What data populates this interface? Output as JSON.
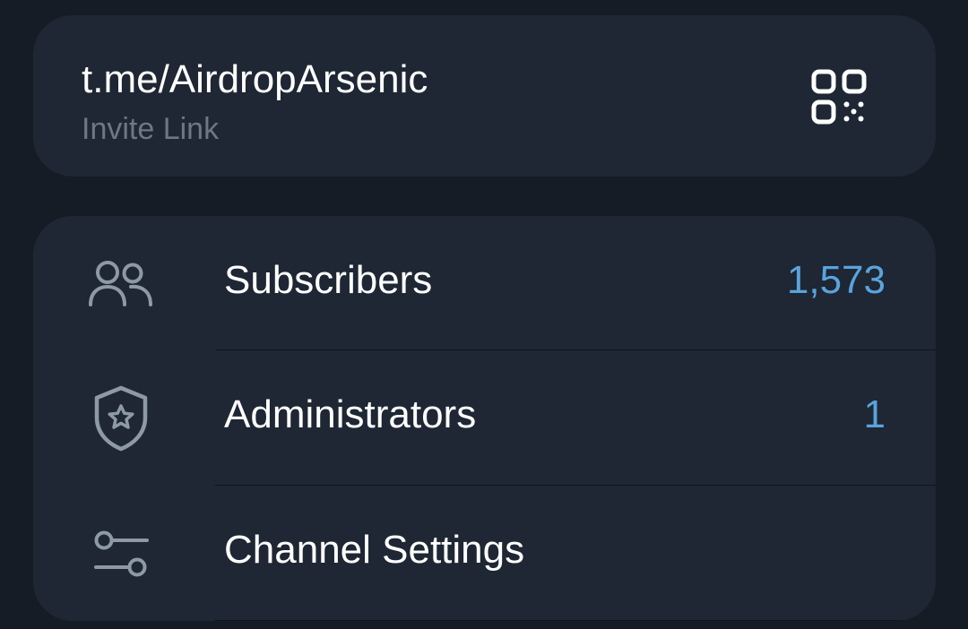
{
  "invite": {
    "link": "t.me/AirdropArsenic",
    "label": "Invite Link",
    "qr_icon": "qr-code-icon"
  },
  "rows": [
    {
      "label": "Subscribers",
      "value": "1,573",
      "icon": "people-icon"
    },
    {
      "label": "Administrators",
      "value": "1",
      "icon": "shield-star-icon"
    },
    {
      "label": "Channel Settings",
      "value": "",
      "icon": "sliders-icon"
    }
  ],
  "colors": {
    "background": "#151c25",
    "card": "#1e2733",
    "text": "#ffffff",
    "secondary_text": "#6c7885",
    "accent": "#5aa3dd",
    "icon": "#8e99a6"
  }
}
